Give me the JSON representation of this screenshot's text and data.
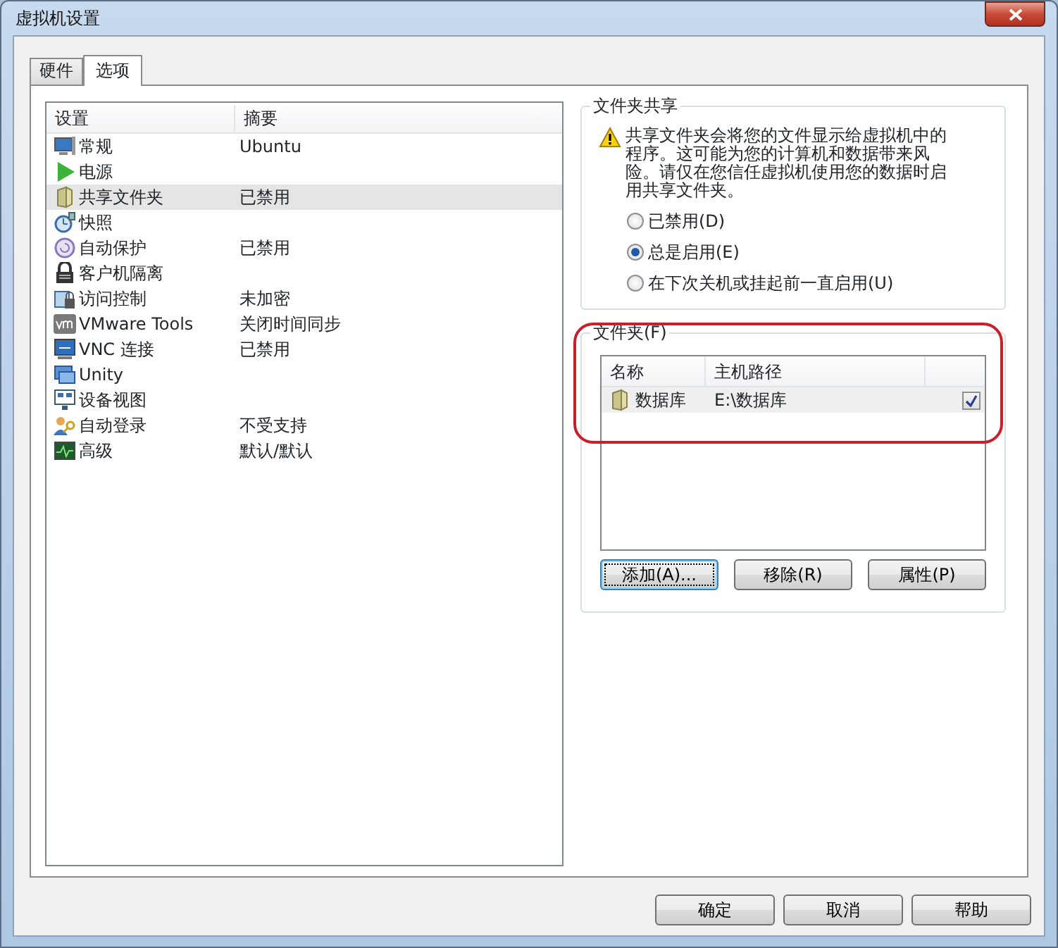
{
  "window": {
    "title": "虚拟机设置"
  },
  "tabs": [
    {
      "label": "硬件",
      "selected": false
    },
    {
      "label": "选项",
      "selected": true
    }
  ],
  "settings_list": {
    "columns": [
      "设置",
      "摘要"
    ],
    "rows": [
      {
        "kind": "display",
        "name": "常规",
        "summary": "Ubuntu",
        "selected": false
      },
      {
        "kind": "power",
        "name": "电源",
        "summary": "",
        "selected": false
      },
      {
        "kind": "folder",
        "name": "共享文件夹",
        "summary": "已禁用",
        "selected": true
      },
      {
        "kind": "snapshot",
        "name": "快照",
        "summary": "",
        "selected": false
      },
      {
        "kind": "protect",
        "name": "自动保护",
        "summary": "已禁用",
        "selected": false
      },
      {
        "kind": "lock",
        "name": "客户机隔离",
        "summary": "",
        "selected": false
      },
      {
        "kind": "access",
        "name": "访问控制",
        "summary": "未加密",
        "selected": false
      },
      {
        "kind": "vm",
        "name": "VMware Tools",
        "summary": "关闭时间同步",
        "selected": false
      },
      {
        "kind": "vnc",
        "name": "VNC 连接",
        "summary": "已禁用",
        "selected": false
      },
      {
        "kind": "unity",
        "name": "Unity",
        "summary": "",
        "selected": false
      },
      {
        "kind": "devices",
        "name": "设备视图",
        "summary": "",
        "selected": false
      },
      {
        "kind": "login",
        "name": "自动登录",
        "summary": "不受支持",
        "selected": false
      },
      {
        "kind": "advanced",
        "name": "高级",
        "summary": "默认/默认",
        "selected": false
      }
    ]
  },
  "folder_sharing": {
    "title": "文件夹共享",
    "warning": "共享文件夹会将您的文件显示给虚拟机中的程序。这可能为您的计算机和数据带来风险。请仅在您信任虚拟机使用您的数据时启用共享文件夹。",
    "options": [
      {
        "label": "已禁用(D)",
        "selected": false
      },
      {
        "label": "总是启用(E)",
        "selected": true
      },
      {
        "label": "在下次关机或挂起前一直启用(U)",
        "selected": false
      }
    ]
  },
  "folders": {
    "title": "文件夹(F)",
    "columns": [
      "名称",
      "主机路径"
    ],
    "rows": [
      {
        "name": "数据库",
        "path": "E:\\数据库",
        "checked": true
      }
    ],
    "buttons": [
      "添加(A)...",
      "移除(R)",
      "属性(P)"
    ]
  },
  "dialog_buttons": [
    "确定",
    "取消",
    "帮助"
  ]
}
